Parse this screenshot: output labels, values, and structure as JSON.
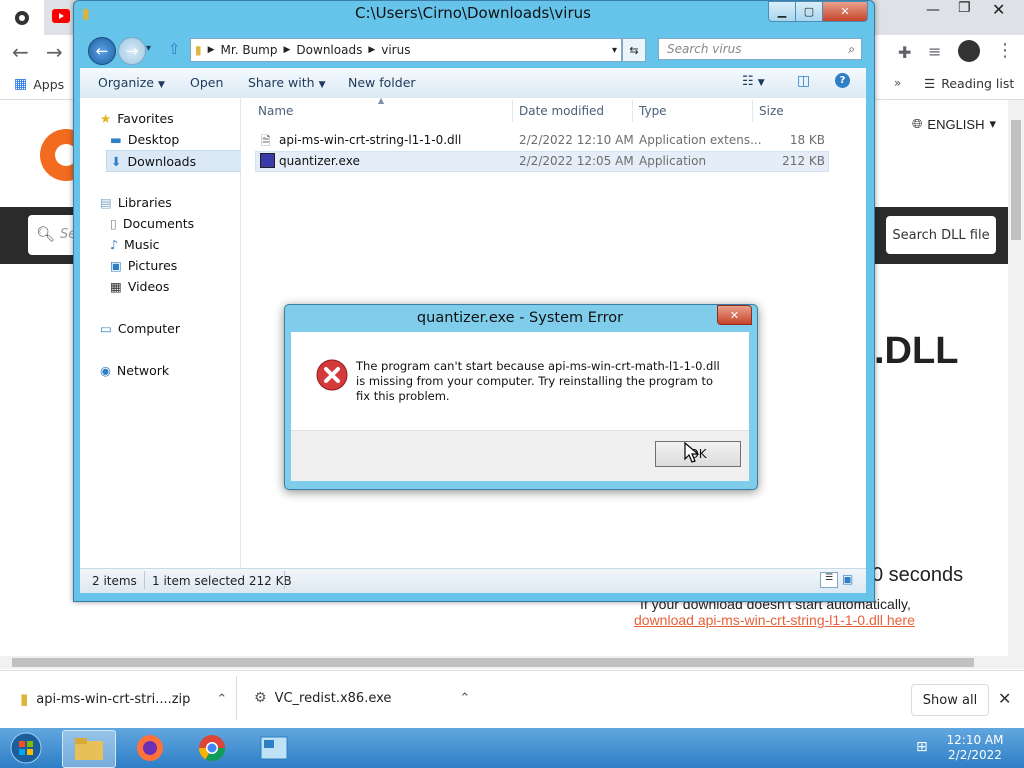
{
  "browser": {
    "bookmarks": {
      "apps": "Apps",
      "reading_list": "Reading list"
    },
    "language": "ENGLISH",
    "search_button": "Search DLL file",
    "search_placeholder_visible": "Se",
    "heading_partial": ".DLL",
    "countdown_partial": "0 seconds",
    "fallback_text": "If your download doesn't start automatically,",
    "fallback_link": "download api-ms-win-crt-string-l1-1-0.dll here",
    "downloads": [
      {
        "name": "api-ms-win-crt-stri....zip"
      },
      {
        "name": "VC_redist.x86.exe"
      }
    ],
    "show_all": "Show all"
  },
  "explorer": {
    "title": "C:\\Users\\Cirno\\Downloads\\virus",
    "breadcrumb": [
      "Mr. Bump",
      "Downloads",
      "virus"
    ],
    "search_placeholder": "Search virus",
    "commands": {
      "organize": "Organize",
      "open": "Open",
      "share_with": "Share with",
      "new_folder": "New folder"
    },
    "nav": {
      "favorites": "Favorites",
      "desktop": "Desktop",
      "downloads": "Downloads",
      "libraries": "Libraries",
      "documents": "Documents",
      "music": "Music",
      "pictures": "Pictures",
      "videos": "Videos",
      "computer": "Computer",
      "network": "Network"
    },
    "columns": {
      "name": "Name",
      "date": "Date modified",
      "type": "Type",
      "size": "Size"
    },
    "files": [
      {
        "name": "api-ms-win-crt-string-l1-1-0.dll",
        "date": "2/2/2022 12:10 AM",
        "type": "Application extens...",
        "size": "18 KB"
      },
      {
        "name": "quantizer.exe",
        "date": "2/2/2022 12:05 AM",
        "type": "Application",
        "size": "212 KB"
      }
    ],
    "status": {
      "items": "2 items",
      "selected": "1 item selected  212 KB"
    }
  },
  "dialog": {
    "title": "quantizer.exe - System Error",
    "message": "The program can't start because api-ms-win-crt-math-l1-1-0.dll is missing from your computer. Try reinstalling the program to fix this problem.",
    "ok": "OK"
  },
  "taskbar": {
    "time": "12:10 AM",
    "date": "2/2/2022"
  }
}
